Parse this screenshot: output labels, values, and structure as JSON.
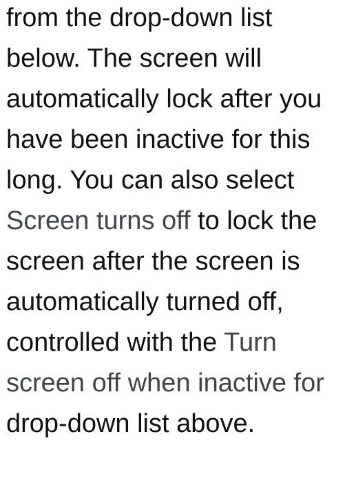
{
  "lines": [
    {
      "segments": [
        {
          "text": "from the drop-down list",
          "gui": false
        }
      ]
    },
    {
      "segments": [
        {
          "text": "below. The screen will",
          "gui": false
        }
      ]
    },
    {
      "segments": [
        {
          "text": "automatically lock after you",
          "gui": false
        }
      ]
    },
    {
      "segments": [
        {
          "text": "have been inactive for this",
          "gui": false
        }
      ]
    },
    {
      "segments": [
        {
          "text": "long. You can also select",
          "gui": false
        }
      ]
    },
    {
      "segments": [
        {
          "text": "Screen turns off",
          "gui": true
        },
        {
          "text": " to lock the",
          "gui": false
        }
      ]
    },
    {
      "segments": [
        {
          "text": "screen after the screen is",
          "gui": false
        }
      ]
    },
    {
      "segments": [
        {
          "text": "automatically turned off,",
          "gui": false
        }
      ]
    },
    {
      "segments": [
        {
          "text": "controlled with the ",
          "gui": false
        },
        {
          "text": "Turn",
          "gui": true
        }
      ]
    },
    {
      "segments": [
        {
          "text": "screen off when inactive for",
          "gui": true
        }
      ]
    },
    {
      "segments": [
        {
          "text": "drop-down list above.",
          "gui": false
        }
      ]
    }
  ],
  "colors": {
    "body_text": "#111111",
    "gui_term": "#3f4448",
    "background": "#ffffff"
  }
}
